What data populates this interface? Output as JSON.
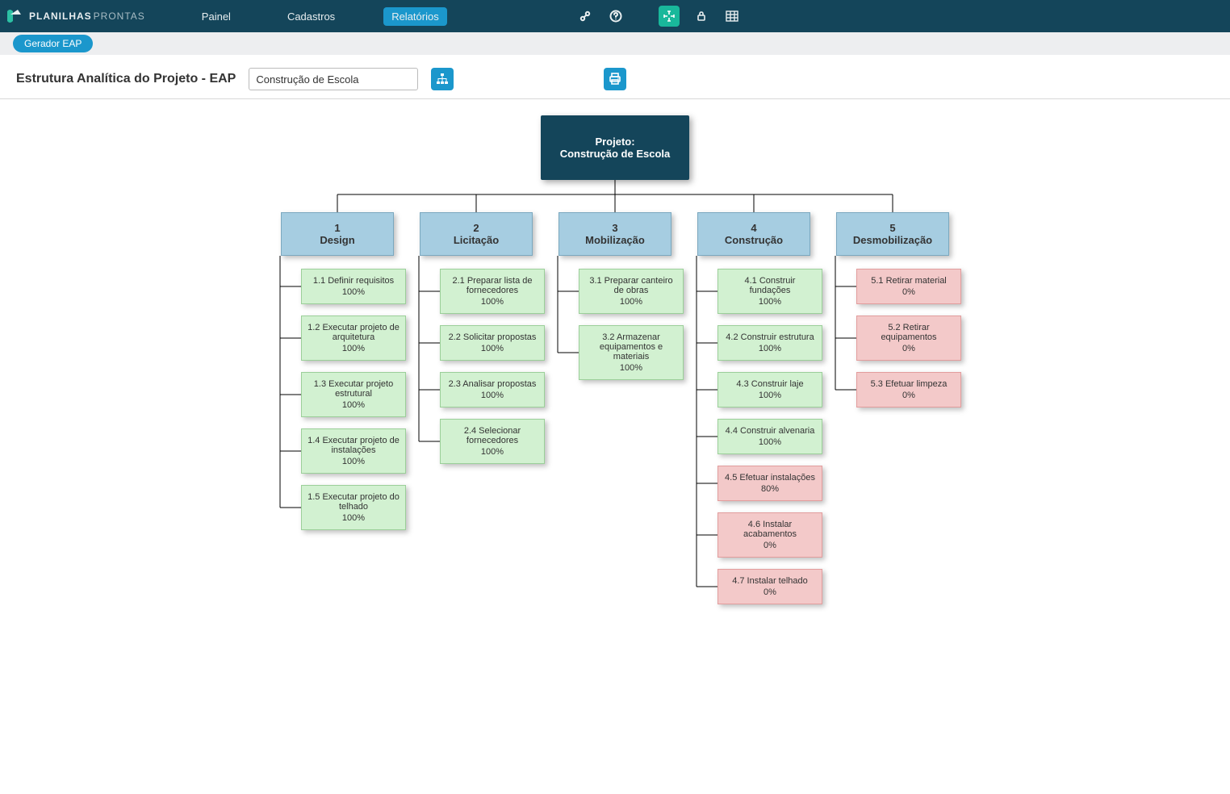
{
  "logo": {
    "part1": "PLANILHAS",
    "part2": "PRONTAS"
  },
  "nav": {
    "painel": "Painel",
    "cadastros": "Cadastros",
    "relatorios": "Relatórios"
  },
  "subnav": {
    "gerador": "Gerador EAP"
  },
  "header": {
    "title": "Estrutura Analítica do Projeto - EAP",
    "project_input": "Construção de Escola"
  },
  "root": {
    "line1": "Projeto:",
    "line2": "Construção de Escola"
  },
  "phases": [
    {
      "num": "1",
      "label": "Design"
    },
    {
      "num": "2",
      "label": "Licitação"
    },
    {
      "num": "3",
      "label": "Mobilização"
    },
    {
      "num": "4",
      "label": "Construção"
    },
    {
      "num": "5",
      "label": "Desmobilização"
    }
  ],
  "tasks": {
    "c1": [
      {
        "label": "1.1 Definir requisitos",
        "pct": "100%",
        "ok": true
      },
      {
        "label": "1.2 Executar projeto de arquitetura",
        "pct": "100%",
        "ok": true
      },
      {
        "label": "1.3 Executar projeto estrutural",
        "pct": "100%",
        "ok": true
      },
      {
        "label": "1.4 Executar projeto de instalações",
        "pct": "100%",
        "ok": true
      },
      {
        "label": "1.5 Executar projeto do telhado",
        "pct": "100%",
        "ok": true
      }
    ],
    "c2": [
      {
        "label": "2.1 Preparar lista de fornecedores",
        "pct": "100%",
        "ok": true
      },
      {
        "label": "2.2 Solicitar propostas",
        "pct": "100%",
        "ok": true
      },
      {
        "label": "2.3 Analisar propostas",
        "pct": "100%",
        "ok": true
      },
      {
        "label": "2.4 Selecionar fornecedores",
        "pct": "100%",
        "ok": true
      }
    ],
    "c3": [
      {
        "label": "3.1 Preparar canteiro de obras",
        "pct": "100%",
        "ok": true
      },
      {
        "label": "3.2 Armazenar equipamentos e materiais",
        "pct": "100%",
        "ok": true
      }
    ],
    "c4": [
      {
        "label": "4.1 Construir fundações",
        "pct": "100%",
        "ok": true
      },
      {
        "label": "4.2 Construir estrutura",
        "pct": "100%",
        "ok": true
      },
      {
        "label": "4.3 Construir laje",
        "pct": "100%",
        "ok": true
      },
      {
        "label": "4.4 Construir alvenaria",
        "pct": "100%",
        "ok": true
      },
      {
        "label": "4.5 Efetuar instalações",
        "pct": "80%",
        "ok": false
      },
      {
        "label": "4.6 Instalar acabamentos",
        "pct": "0%",
        "ok": false
      },
      {
        "label": "4.7 Instalar telhado",
        "pct": "0%",
        "ok": false
      }
    ],
    "c5": [
      {
        "label": "5.1 Retirar material",
        "pct": "0%",
        "ok": false
      },
      {
        "label": "5.2 Retirar equipamentos",
        "pct": "0%",
        "ok": false
      },
      {
        "label": "5.3 Efetuar limpeza",
        "pct": "0%",
        "ok": false
      }
    ]
  }
}
